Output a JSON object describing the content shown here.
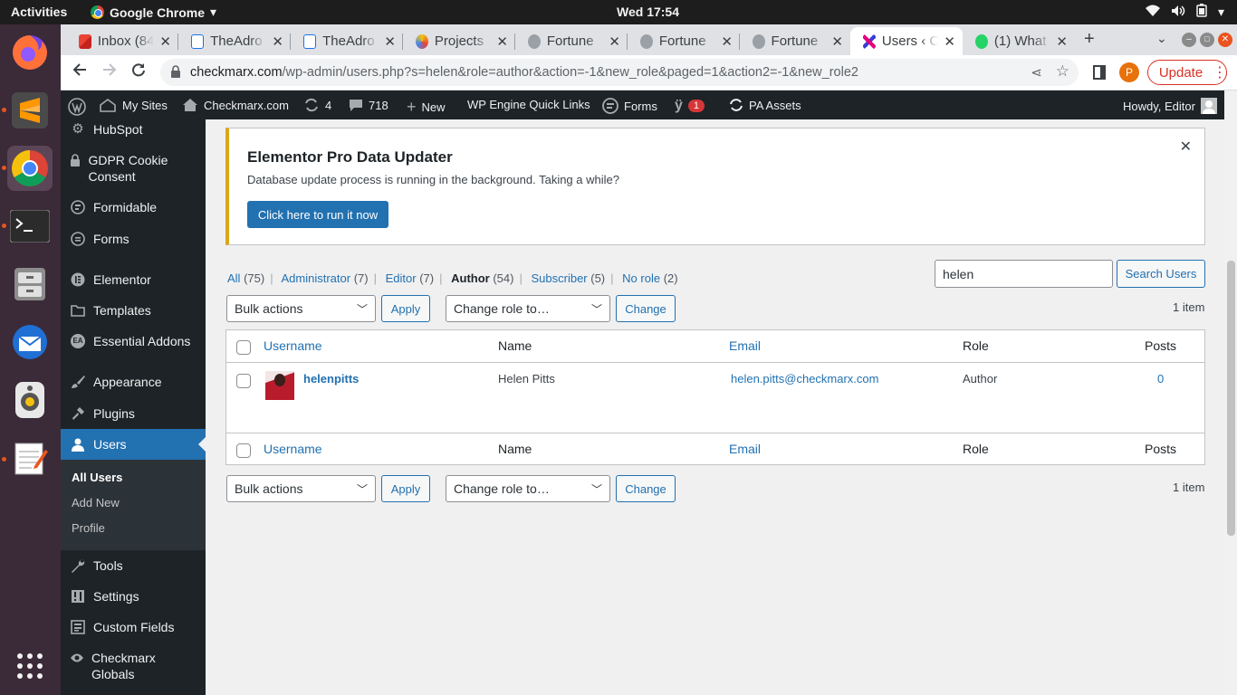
{
  "system": {
    "activities": "Activities",
    "app_name": "Google Chrome",
    "clock": "Wed 17:54"
  },
  "browser": {
    "tabs": [
      {
        "title": "Inbox (84",
        "icon": "gmail-icon"
      },
      {
        "title": "TheAdro",
        "icon": "page-icon"
      },
      {
        "title": "TheAdro",
        "icon": "page-icon"
      },
      {
        "title": "Projects",
        "icon": "projects-icon"
      },
      {
        "title": "Fortune",
        "icon": "globe-icon"
      },
      {
        "title": "Fortune",
        "icon": "globe-icon"
      },
      {
        "title": "Fortune",
        "icon": "globe-icon"
      },
      {
        "title": "Users ‹ C",
        "icon": "checkmarx-icon",
        "active": true
      },
      {
        "title": "(1) What",
        "icon": "whatsapp-icon"
      }
    ],
    "url_host": "checkmarx.com",
    "url_path": "/wp-admin/users.php?s=helen&role=author&action=-1&new_role&paged=1&action2=-1&new_role2",
    "profile_initial": "P",
    "update_label": "Update"
  },
  "adminbar": {
    "my_sites": "My Sites",
    "site_name": "Checkmarx.com",
    "updates_count": "4",
    "comments_count": "718",
    "new_label": "New",
    "wp_engine": "WP Engine Quick Links",
    "forms": "Forms",
    "yoast_count": "1",
    "pa_assets": "PA Assets",
    "howdy": "Howdy, Editor"
  },
  "sidebar": {
    "items": [
      {
        "label": "HubSpot",
        "icon": "hubspot-icon"
      },
      {
        "label": "GDPR Cookie Consent",
        "icon": "lock-icon"
      },
      {
        "label": "Formidable",
        "icon": "formidable-icon"
      },
      {
        "label": "Forms",
        "icon": "forms-icon"
      },
      {
        "label": "Elementor",
        "icon": "elementor-icon"
      },
      {
        "label": "Templates",
        "icon": "folder-icon"
      },
      {
        "label": "Essential Addons",
        "icon": "ea-icon"
      },
      {
        "label": "Appearance",
        "icon": "brush-icon"
      },
      {
        "label": "Plugins",
        "icon": "plug-icon"
      },
      {
        "label": "Users",
        "icon": "users-icon"
      },
      {
        "label": "Tools",
        "icon": "wrench-icon"
      },
      {
        "label": "Settings",
        "icon": "settings-icon"
      },
      {
        "label": "Custom Fields",
        "icon": "fields-icon"
      },
      {
        "label": "Checkmarx Globals",
        "icon": "eye-icon"
      }
    ],
    "submenu": [
      "All Users",
      "Add New",
      "Profile"
    ]
  },
  "notice": {
    "title": "Elementor Pro Data Updater",
    "message": "Database update process is running in the background. Taking a while?",
    "button": "Click here to run it now"
  },
  "filters": {
    "views": [
      {
        "label": "All",
        "count": "(75)"
      },
      {
        "label": "Administrator",
        "count": "(7)"
      },
      {
        "label": "Editor",
        "count": "(7)"
      },
      {
        "label": "Author",
        "count": "(54)",
        "current": true
      },
      {
        "label": "Subscriber",
        "count": "(5)"
      },
      {
        "label": "No role",
        "count": "(2)"
      }
    ],
    "search_value": "helen",
    "search_button": "Search Users",
    "bulk_actions": "Bulk actions",
    "apply": "Apply",
    "change_role": "Change role to…",
    "change": "Change",
    "item_count": "1 item"
  },
  "table": {
    "columns": [
      "Username",
      "Name",
      "Email",
      "Role",
      "Posts"
    ],
    "rows": [
      {
        "username": "helenpitts",
        "name": "Helen Pitts",
        "email": "helen.pitts@checkmarx.com",
        "role": "Author",
        "posts": "0"
      }
    ]
  }
}
